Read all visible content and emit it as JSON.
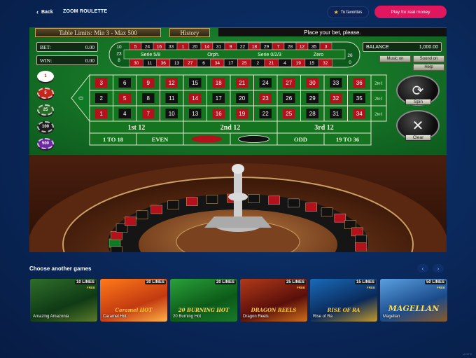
{
  "header": {
    "back_label": "Back",
    "game_title": "ZOOM ROULETTE",
    "favorites_label": "To favorites",
    "play_real_label": "Play for real money"
  },
  "game": {
    "table_limits": "Table Limits: Min 3 - Max 500",
    "history_label": "History",
    "message": "Place your bet, please.",
    "bet_label": "BET:",
    "bet_value": "0.00",
    "win_label": "WIN:",
    "win_value": "0.00",
    "balance_label": "BALANCE",
    "balance_value": "1,000.00",
    "music_label": "Music on",
    "sound_label": "Sound on",
    "help_label": "Help",
    "spin_label": "Spin",
    "clear_label": "Clear",
    "chips": [
      "1",
      "5",
      "25",
      "100",
      "500"
    ],
    "racetrack": {
      "top_numbers": [
        "5",
        "24",
        "16",
        "33",
        "1",
        "20",
        "14",
        "31",
        "9",
        "22",
        "18",
        "29",
        "7",
        "28",
        "12",
        "35",
        "3"
      ],
      "bottom_numbers": [
        "30",
        "11",
        "36",
        "13",
        "27",
        "6",
        "34",
        "17",
        "25",
        "2",
        "21",
        "4",
        "19",
        "15",
        "32"
      ],
      "left_numbers": [
        "10",
        "23",
        "8"
      ],
      "right_numbers": [
        "26",
        "0"
      ],
      "sections": [
        "Serie 5/8",
        "Orph.",
        "Serie 0/2/3",
        "Zero"
      ]
    },
    "board": {
      "zero": "0",
      "rows": [
        [
          "3",
          "6",
          "9",
          "12",
          "15",
          "18",
          "21",
          "24",
          "27",
          "30",
          "33",
          "36"
        ],
        [
          "2",
          "5",
          "8",
          "11",
          "14",
          "17",
          "20",
          "23",
          "26",
          "29",
          "32",
          "35"
        ],
        [
          "1",
          "4",
          "7",
          "10",
          "13",
          "16",
          "19",
          "22",
          "25",
          "28",
          "31",
          "34"
        ]
      ],
      "columns": [
        "2to1",
        "2to1",
        "2to1"
      ],
      "dozens": [
        "1st 12",
        "2nd 12",
        "3rd 12"
      ],
      "outside": [
        "1 TO 18",
        "EVEN",
        "",
        "",
        "ODD",
        "19 TO 36"
      ]
    }
  },
  "more_games": {
    "heading": "Choose another games",
    "prev": "‹",
    "next": "›",
    "tiles": [
      {
        "name": "Amazing Amazonia",
        "lines": "10",
        "lines_word": "LINES",
        "free": "FREE"
      },
      {
        "name": "Caramel Hot",
        "lines": "30",
        "lines_word": "LINES",
        "free": "",
        "logo": "Caramel HOT"
      },
      {
        "name": "20 Burning Hot",
        "lines": "20",
        "lines_word": "LINES",
        "free": "",
        "logo": "20 BURNING HOT"
      },
      {
        "name": "Dragon Reels",
        "lines": "25",
        "lines_word": "LINES",
        "free": "FREE",
        "logo": "DRAGON REELS"
      },
      {
        "name": "Rise of Ra",
        "lines": "15",
        "lines_word": "LINES",
        "free": "FREE",
        "logo": "RISE OF RA"
      },
      {
        "name": "Magellan",
        "lines": "50",
        "lines_word": "LINES",
        "free": "FREE",
        "logo": "MAGELLAN"
      }
    ]
  },
  "footer_mark": "v0.47.2"
}
